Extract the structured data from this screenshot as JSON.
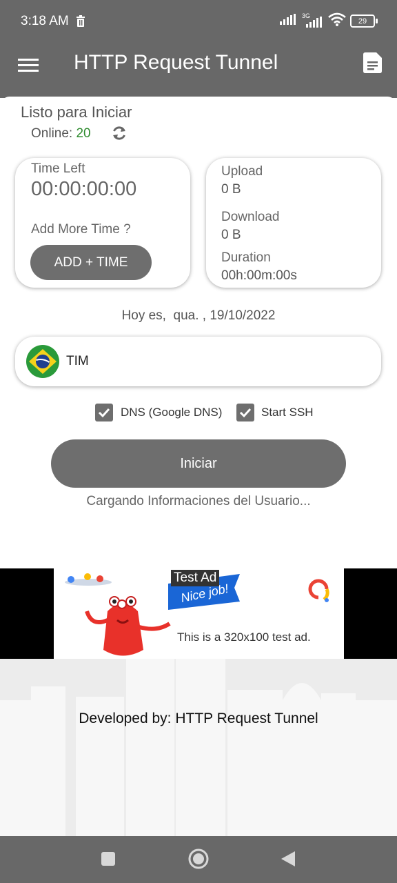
{
  "status_bar": {
    "time": "3:18 AM",
    "network_type": "3G",
    "battery": "29"
  },
  "app_bar": {
    "title": "HTTP Request Tunnel",
    "menu_icon": "hamburger-menu-icon",
    "action_icon": "document-icon"
  },
  "connection": {
    "status": "Listo para Iniciar",
    "online_label": "Online:",
    "online_count": "20",
    "refresh_icon": "refresh-icon"
  },
  "time_panel": {
    "time_left_label": "Time Left",
    "time_left_value": "00:00:00:00",
    "add_more_label": "Add More Time ?",
    "add_time_button": "ADD + TIME"
  },
  "stats_panel": {
    "upload_label": "Upload",
    "upload_value": "0 B",
    "download_label": "Download",
    "download_value": "0 B",
    "duration_label": "Duration",
    "duration_value": "00h:00m:00s"
  },
  "date_text": "Hoy es,  qua. , 19/10/2022",
  "carrier": {
    "name": "TIM",
    "flag_icon": "brazil-flag-icon"
  },
  "options": {
    "dns_label": "DNS (Google DNS)",
    "dns_checked": true,
    "ssh_label": "Start SSH",
    "ssh_checked": true
  },
  "start_button": "Iniciar",
  "loading_text": "Cargando Informaciones del Usuario...",
  "ad": {
    "label": "Test Ad",
    "banner_text": "Nice job!",
    "text": "This is a 320x100 test ad."
  },
  "footer": {
    "developed_by": "Developed by: HTTP Request Tunnel"
  },
  "colors": {
    "bar": "#686868",
    "button": "#6e6e6e",
    "online_count": "#2e8b2e"
  }
}
